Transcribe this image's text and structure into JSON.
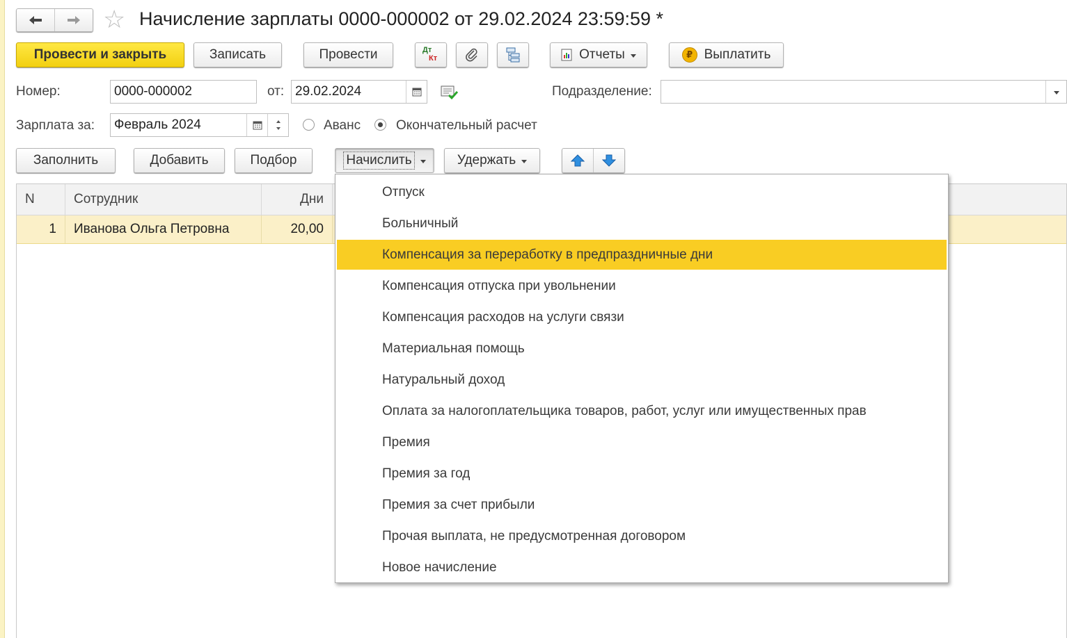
{
  "window": {
    "title": "Начисление зарплаты 0000-000002 от 29.02.2024 23:59:59 *"
  },
  "nav": {
    "back_icon": "arrow-left-icon",
    "forward_icon": "arrow-right-icon",
    "favorite_icon": "star-icon"
  },
  "toolbar": {
    "post_close": "Провести и закрыть",
    "save": "Записать",
    "post": "Провести",
    "dtkt_top": "Дт",
    "dtkt_bottom": "Кт",
    "reports": "Отчеты",
    "pay": "Выплатить"
  },
  "form": {
    "number_label": "Номер:",
    "number_value": "0000-000002",
    "date_label": "от:",
    "date_value": "29.02.2024",
    "department_label": "Подразделение:",
    "department_value": "",
    "salary_for_label": "Зарплата за:",
    "salary_for_value": "Февраль 2024",
    "radio_advance": "Аванс",
    "radio_final": "Окончательный расчет"
  },
  "table_toolbar": {
    "fill": "Заполнить",
    "add": "Добавить",
    "select": "Подбор",
    "accrue": "Начислить",
    "withhold": "Удержать"
  },
  "table": {
    "columns": [
      "N",
      "Сотрудник",
      "Дни"
    ],
    "rows": [
      {
        "n": "1",
        "employee": "Иванова Ольга Петровна",
        "days": "20,00"
      }
    ]
  },
  "accrue_menu": {
    "items": [
      "Отпуск",
      "Больничный",
      "Компенсация за переработку в предпраздничные дни",
      "Компенсация отпуска при увольнении",
      "Компенсация расходов на услуги связи",
      "Материальная помощь",
      "Натуральный доход",
      "Оплата за налогоплательщика товаров, работ, услуг или имущественных прав",
      "Премия",
      "Премия за год",
      "Премия за счет прибыли",
      "Прочая выплата, не предусмотренная договором",
      "Новое начисление"
    ],
    "highlighted_index": 2
  },
  "colors": {
    "accent_yellow": "#f9cd23",
    "row_highlight": "#fbf0c8",
    "arrow_blue": "#2f8fe0"
  }
}
